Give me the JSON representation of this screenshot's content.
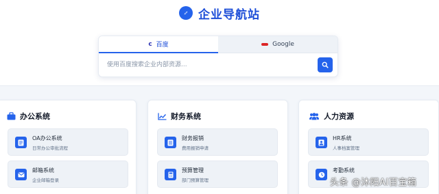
{
  "header": {
    "title": "企业导航站",
    "logo_icon": "compass-icon",
    "accent_color": "#2563eb"
  },
  "search": {
    "tabs": [
      {
        "label": "百度",
        "icon": "baidu-icon",
        "active": true
      },
      {
        "label": "Google",
        "icon": "google-icon",
        "active": false
      }
    ],
    "placeholder": "使用百度搜索企业内部资源...",
    "button_icon": "search-icon"
  },
  "panels": [
    {
      "title": "办公系统",
      "icon": "briefcase-icon",
      "items": [
        {
          "name": "OA办公系统",
          "desc": "日常办公审批流程",
          "icon": "document-icon"
        },
        {
          "name": "邮箱系统",
          "desc": "企业邮箱登录",
          "icon": "envelope-icon"
        }
      ]
    },
    {
      "title": "财务系统",
      "icon": "chart-line-icon",
      "items": [
        {
          "name": "财务报销",
          "desc": "费用报销申请",
          "icon": "receipt-icon"
        },
        {
          "name": "预算管理",
          "desc": "部门预算管理",
          "icon": "calculator-icon"
        }
      ]
    },
    {
      "title": "人力资源",
      "icon": "users-icon",
      "items": [
        {
          "name": "HR系统",
          "desc": "人事档案管理",
          "icon": "user-icon"
        },
        {
          "name": "考勤系统",
          "desc": "",
          "icon": "clock-icon"
        }
      ]
    }
  ],
  "watermark": "头条 @沐阳AI百宝箱"
}
